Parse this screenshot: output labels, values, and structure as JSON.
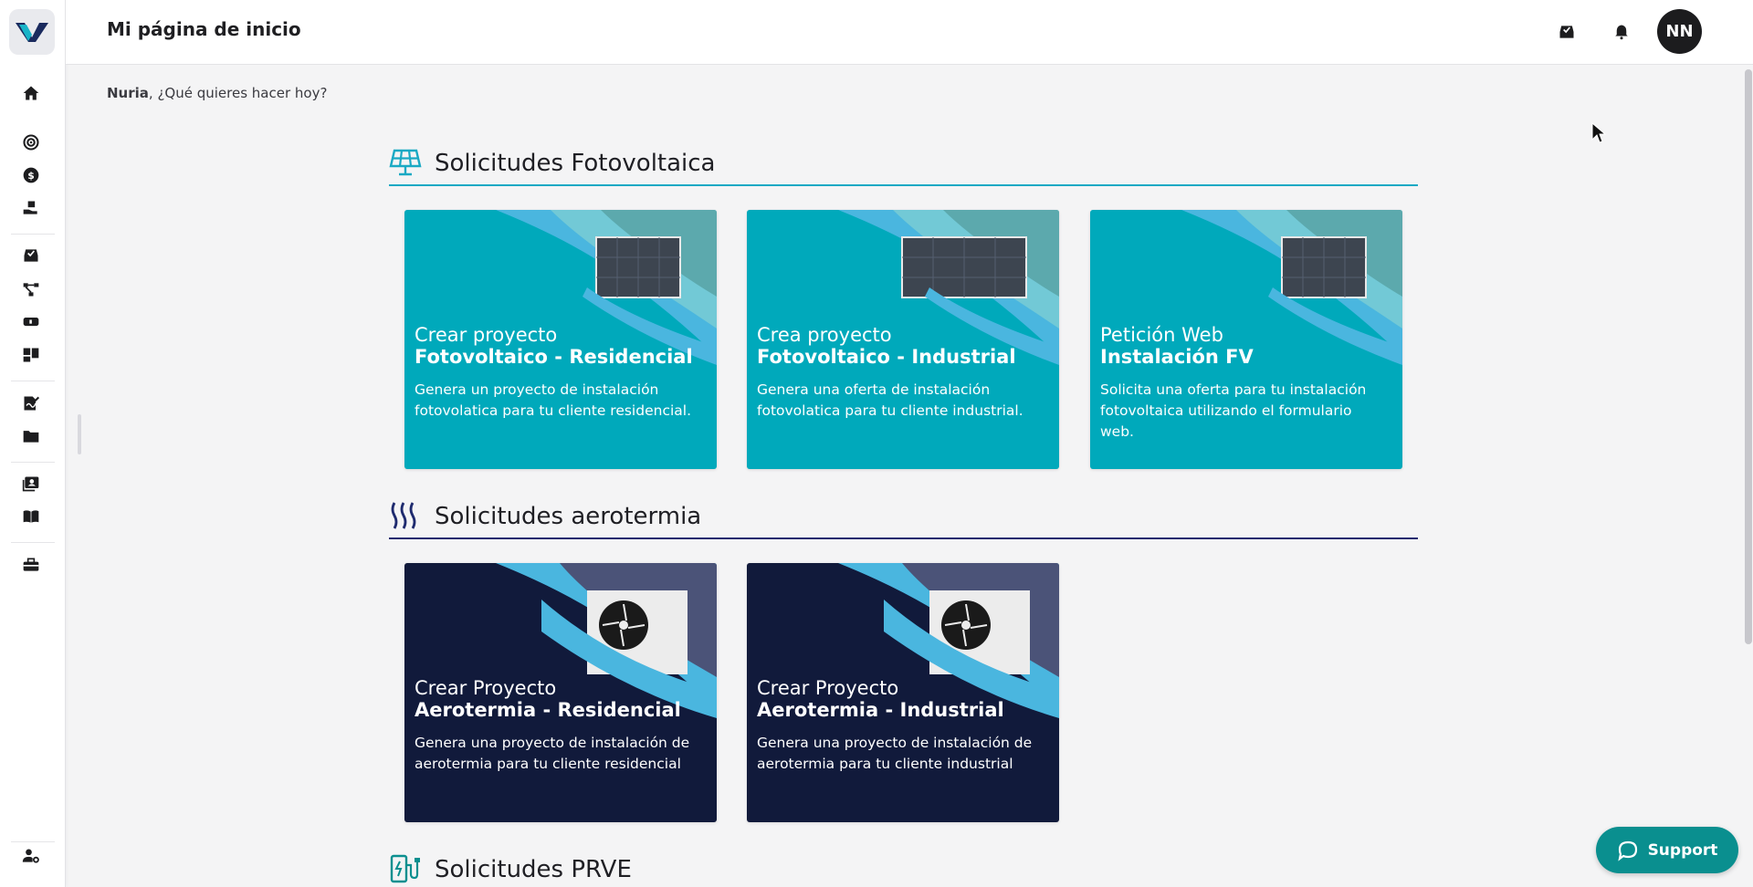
{
  "header": {
    "title": "Mi página de inicio",
    "avatar_initials": "NN"
  },
  "greeting": {
    "name": "Nuria",
    "text": ", ¿Qué quieres hacer hoy?"
  },
  "sidebar": {
    "items": [
      {
        "icon": "home-icon"
      },
      {
        "icon": "target-icon"
      },
      {
        "icon": "dollar-icon"
      },
      {
        "icon": "hand-box-icon"
      },
      {
        "icon": "inbox-check-icon"
      },
      {
        "icon": "flow-icon"
      },
      {
        "icon": "truck-icon"
      },
      {
        "icon": "dashboard-icon"
      },
      {
        "icon": "sign-doc-icon"
      },
      {
        "icon": "folder-icon"
      },
      {
        "icon": "contacts-icon"
      },
      {
        "icon": "book-icon"
      },
      {
        "icon": "toolbox-icon"
      },
      {
        "icon": "user-settings-icon"
      }
    ]
  },
  "sections": {
    "fv": {
      "title": "Solicitudes Fotovoltaica",
      "accent": "#19a9c4",
      "cards": [
        {
          "title1": "Crear proyecto",
          "title2": "Fotovoltaico - Residencial",
          "desc": "Genera un proyecto de instalación fotovolatica para tu cliente residencial."
        },
        {
          "title1": "Crea proyecto",
          "title2": "Fotovoltaico - Industrial",
          "desc": "Genera una oferta de instalación fotovolatica para tu cliente industrial."
        },
        {
          "title1": "Petición Web",
          "title2": "Instalación FV",
          "desc": "Solicita una oferta para tu instalación fotovoltaica utilizando el formulario web."
        }
      ]
    },
    "aero": {
      "title": "Solicitudes aerotermia",
      "accent": "#1e2a6e",
      "cards": [
        {
          "title1": "Crear Proyecto",
          "title2": "Aerotermia - Residencial",
          "desc": "Genera una proyecto de instalación de aerotermia para tu cliente residencial"
        },
        {
          "title1": "Crear Proyecto",
          "title2": "Aerotermia - Industrial",
          "desc": "Genera una proyecto de instalación de aerotermia para tu cliente industrial"
        }
      ]
    },
    "prve": {
      "title": "Solicitudes PRVE"
    }
  },
  "support": {
    "label": "Support"
  },
  "colors": {
    "teal_card": "#00a6b8",
    "navy_card": "#111a3b",
    "support_bg": "#0a8f8f"
  }
}
